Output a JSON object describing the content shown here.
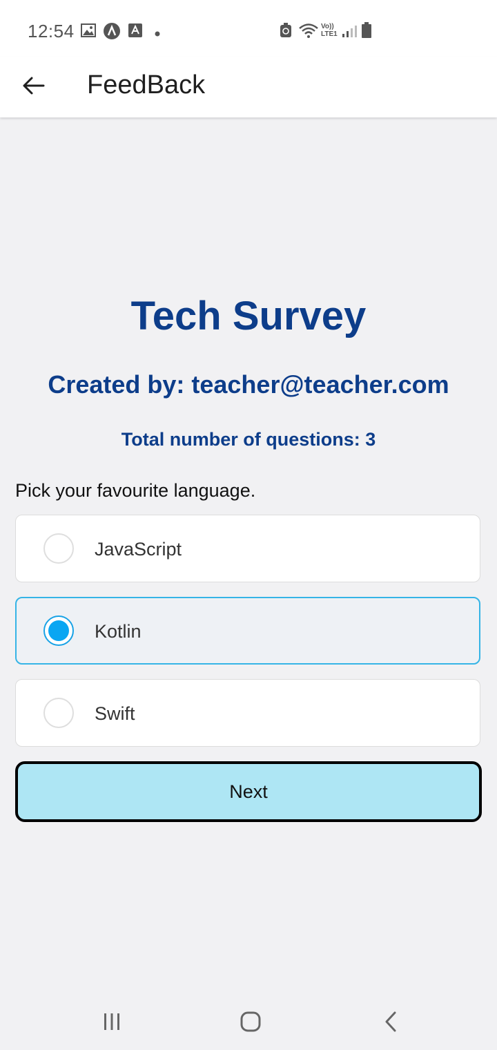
{
  "status_bar": {
    "time": "12:54",
    "icons_left": [
      "image-icon",
      "app-a-icon",
      "app-text-icon",
      "dot-icon"
    ],
    "icons_right": [
      "data-saver-icon",
      "wifi-icon",
      "volte-icon",
      "signal-icon",
      "battery-icon"
    ],
    "volte_label": "Vo))\nLTE1"
  },
  "app_bar": {
    "title": "FeedBack"
  },
  "survey": {
    "title": "Tech Survey",
    "created_by": "Created by: teacher@teacher.com",
    "total_questions": "Total number of questions: 3",
    "question": "Pick your favourite language.",
    "options": [
      {
        "label": "JavaScript",
        "selected": false
      },
      {
        "label": "Kotlin",
        "selected": true
      },
      {
        "label": "Swift",
        "selected": false
      }
    ],
    "next_label": "Next"
  },
  "colors": {
    "heading": "#0d3d8a",
    "radio_selected": "#0aa6f2",
    "selected_border": "#35b4e6",
    "next_button_bg": "#aee6f4",
    "background": "#f1f1f3"
  },
  "nav_bar": {
    "icons": [
      "recent-apps-icon",
      "home-icon",
      "back-nav-icon"
    ]
  }
}
